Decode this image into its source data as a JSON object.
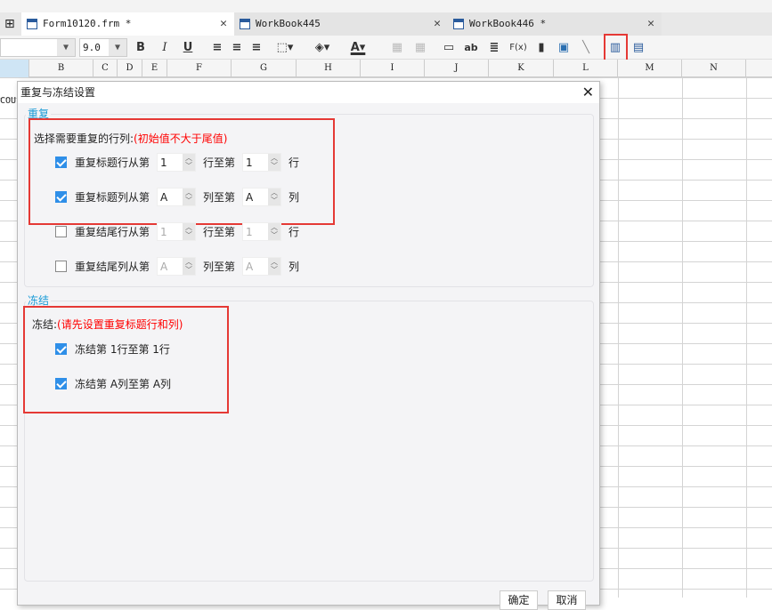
{
  "tabs": [
    {
      "label": "Form10120.frm *",
      "active": true
    },
    {
      "label": "WorkBook445"
    },
    {
      "label": "WorkBook446 *"
    }
  ],
  "toolbar": {
    "font_name": "",
    "font_size": "9.0",
    "bold": "B",
    "italic": "I",
    "underline": "U",
    "text_label": "ab",
    "formula": "F(x)",
    "highlight_color": "#e53935"
  },
  "columns": [
    "B",
    "C",
    "D",
    "E",
    "F",
    "G",
    "H",
    "I",
    "J",
    "K",
    "L",
    "M",
    "N"
  ],
  "cell_fragment": "COU",
  "dialog": {
    "title": "重复与冻结设置",
    "repeat": {
      "group_label": "重复",
      "hint_label": "选择需要重复的行列:",
      "hint_note": "(初始值不大于尾值)",
      "rows": [
        {
          "label": "重复标题行从第",
          "from": "1",
          "mid": "行至第",
          "to": "1",
          "end": "行",
          "checked": true
        },
        {
          "label": "重复标题列从第",
          "from": "A",
          "mid": "列至第",
          "to": "A",
          "end": "列",
          "checked": true
        },
        {
          "label": "重复结尾行从第",
          "from": "1",
          "mid": "行至第",
          "to": "1",
          "end": "行",
          "checked": false
        },
        {
          "label": "重复结尾列从第",
          "from": "A",
          "mid": "列至第",
          "to": "A",
          "end": "列",
          "checked": false
        }
      ]
    },
    "freeze": {
      "group_label": "冻结",
      "hint_label": "冻结:",
      "hint_note": "(请先设置重复标题行和列)",
      "rows": [
        {
          "label": "冻结第 1行至第 1行",
          "checked": true
        },
        {
          "label": "冻结第 A列至第 A列",
          "checked": true
        }
      ]
    },
    "ok": "确定",
    "cancel": "取消"
  }
}
